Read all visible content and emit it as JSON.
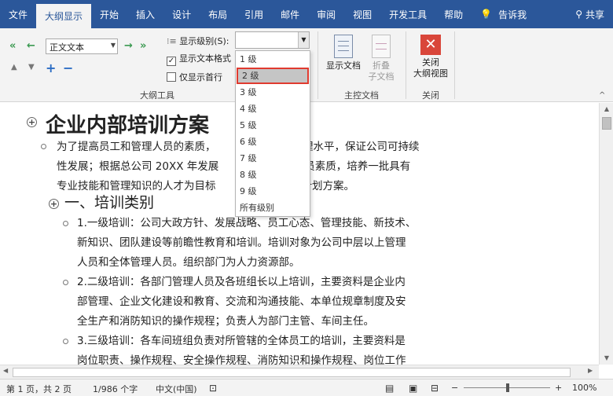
{
  "tabs": [
    "文件",
    "大纲显示",
    "开始",
    "插入",
    "设计",
    "布局",
    "引用",
    "邮件",
    "审阅",
    "视图",
    "开发工具",
    "帮助"
  ],
  "tell_me": "告诉我",
  "share": "共享",
  "ribbon": {
    "level_value": "正文文本",
    "show_level_label": "显示级别(S):",
    "show_format_label": "显示文本格式",
    "first_line_label": "仅显示首行",
    "outline_tools_label": "大纲工具",
    "show_document": "显示文档",
    "collapse_sub": [
      "折叠",
      "子文档"
    ],
    "master_doc_label": "主控文档",
    "close_label": [
      "关闭",
      "大纲视图"
    ],
    "close_group_label": "关闭"
  },
  "dropdown": [
    "1 级",
    "2 级",
    "3 级",
    "4 级",
    "5 级",
    "6 级",
    "7 级",
    "8 级",
    "9 级",
    "所有级别"
  ],
  "doc": {
    "title": "企业内部培训方案",
    "intro": [
      "为了提高员工和管理人员的素质，",
      "管理水平，保证公司可持续",
      "性发展；根据总公司 20XX 年发展",
      "体人员素质，培养一批具有",
      "专业技能和管理知识的人才为目标",
      "培训计划方案。"
    ],
    "h2": "一、培训类别",
    "items": [
      [
        "1.一级培训：公司大政方针、发展战略、员工心态、管理技能、新技术、",
        "新知识、团队建设等前瞻性教育和培训。培训对象为公司中层以上管理",
        "人员和全体管理人员。组织部门为人力资源部。"
      ],
      [
        "2.二级培训：各部门管理人员及各班组长以上培训，主要资料是企业内",
        "部管理、企业文化建设和教育、交流和沟通技能、本单位规章制度及安",
        "全生产和消防知识的操作规程；负责人为部门主管、车间主任。"
      ],
      [
        "3.三级培训：各车间班组负责对所管辖的全体员工的培训，主要资料是",
        "岗位职责、操作规程、安全操作规程、消防知识和操作规程、岗位工作"
      ]
    ]
  },
  "status": {
    "page": "第 1 页，共 2 页",
    "words": "1/986 个字",
    "lang": "中文(中国)",
    "zoom": "100%"
  }
}
